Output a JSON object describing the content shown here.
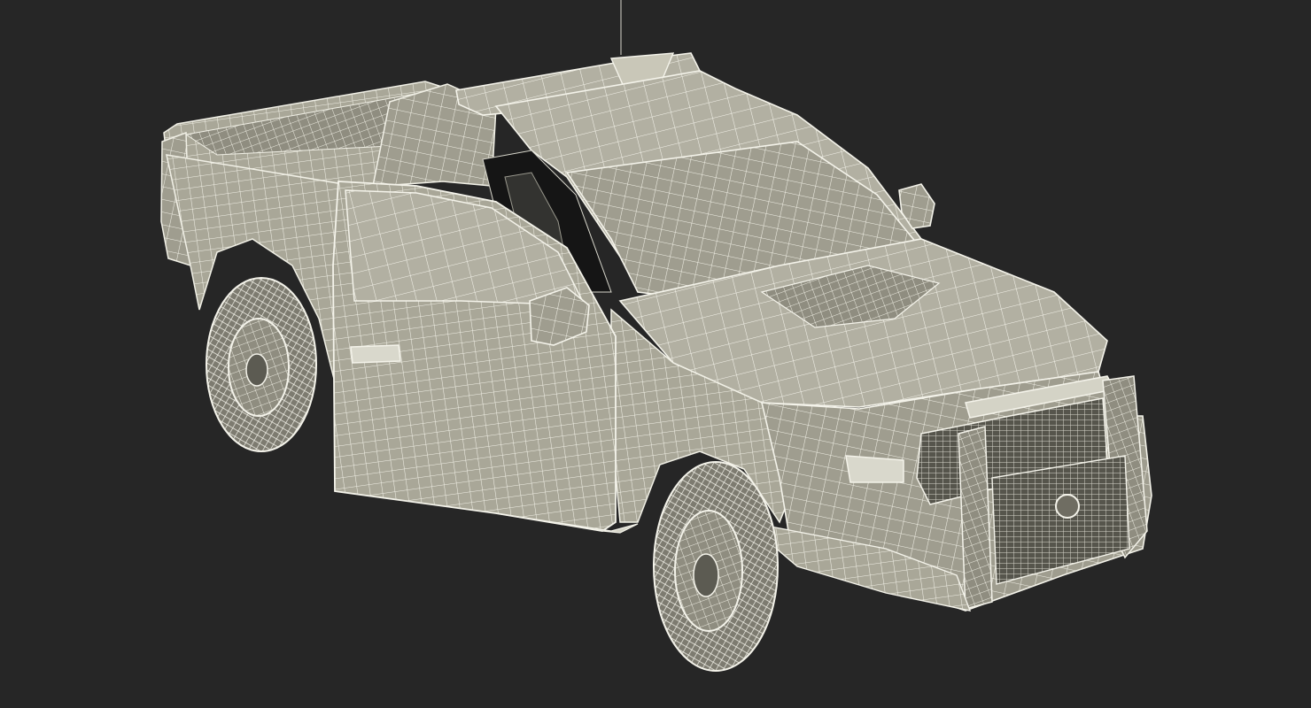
{
  "scene": {
    "subject": "wireframe-pickup-truck",
    "colors": {
      "background": "#262626",
      "mesh_fill": "#a9a798",
      "mesh_dark": "#6f6d62",
      "wire": "#f1f0e6",
      "interior": "#151515"
    }
  }
}
